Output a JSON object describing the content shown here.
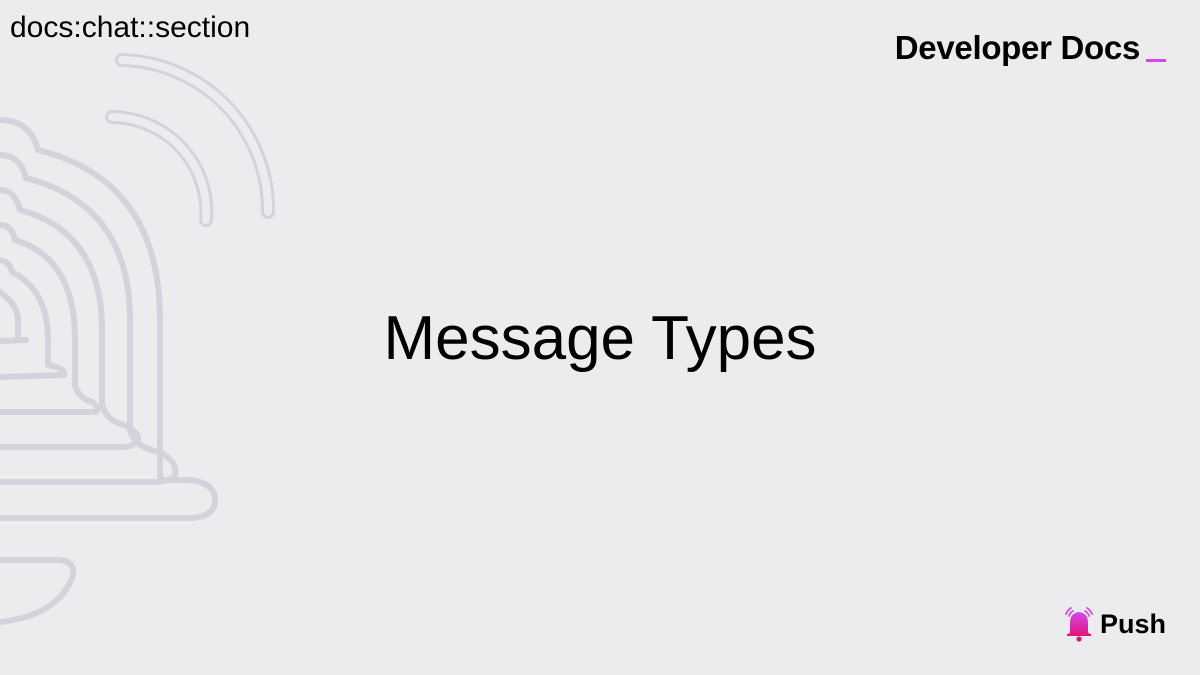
{
  "breadcrumb": "docs:chat::section",
  "brand": {
    "title": "Developer Docs",
    "cursor_color": "#d548ec"
  },
  "section_title": "Message Types",
  "logo": {
    "word": "Push",
    "icon": "push-bell-icon",
    "gradient": [
      "#d548ec",
      "#e1147b"
    ]
  },
  "decoration": {
    "icon": "bell-ringing-icon",
    "stroke_color": "#d4d3dc"
  }
}
